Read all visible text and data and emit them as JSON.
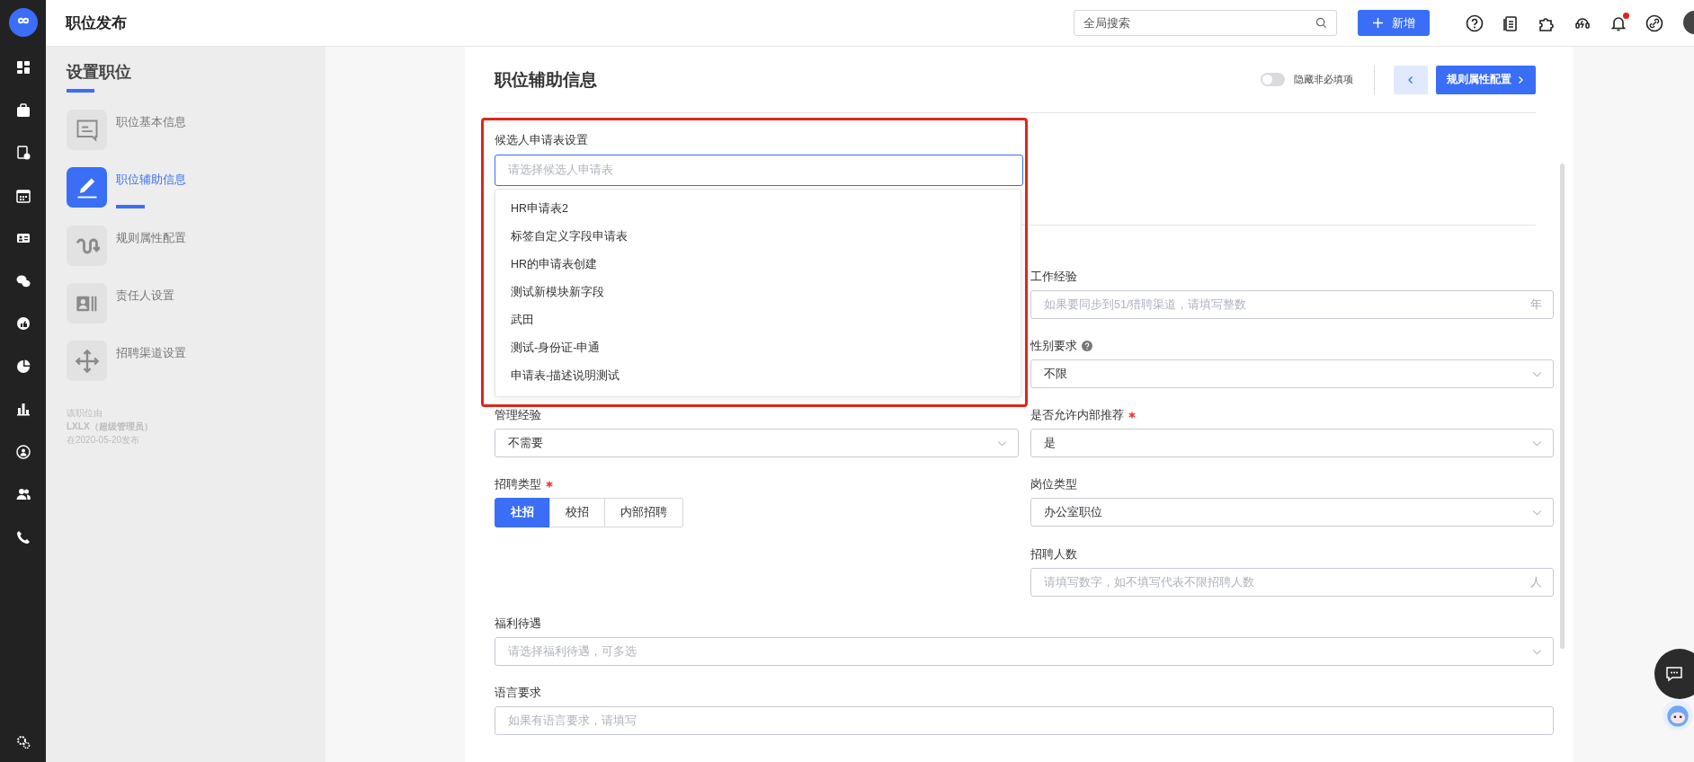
{
  "header": {
    "title": "职位发布",
    "search": {
      "placeholder": "全局搜索"
    },
    "new_button": "新增",
    "notification": true
  },
  "steps": {
    "title": "设置职位",
    "items": [
      {
        "label": "职位基本信息",
        "kind": "message",
        "selected": false
      },
      {
        "label": "职位辅助信息",
        "kind": "pencil",
        "selected": true
      },
      {
        "label": "规则属性配置",
        "kind": "wave",
        "selected": false
      },
      {
        "label": "责任人设置",
        "kind": "contact",
        "selected": false
      },
      {
        "label": "招聘渠道设置",
        "kind": "move",
        "selected": false
      }
    ],
    "note": [
      "该职位由",
      "LXLX（超级管理员）",
      "在2020-05-20发布"
    ]
  },
  "page": {
    "title": "职位辅助信息",
    "hide_optional": {
      "label": "隐藏非必填项",
      "on": false
    },
    "next_button": "规则属性配置"
  },
  "application_form": {
    "label": "候选人申请表设置",
    "placeholder": "请选择候选人申请表",
    "expanded": true,
    "highlighted": true,
    "options": [
      {
        "label": "HR申请表2",
        "selected": false
      },
      {
        "label": "标签自定义字段申请表",
        "selected": false
      },
      {
        "label": "HR的申请表创建",
        "selected": false
      },
      {
        "label": "测试新模块新字段",
        "selected": false
      },
      {
        "label": "武田",
        "selected": false
      },
      {
        "label": "测试-身份证-申通",
        "selected": false
      },
      {
        "label": "申请表-描述说明测试",
        "selected": false
      }
    ]
  },
  "rows": [
    {
      "right": {
        "kind": "input",
        "label": "工作经验",
        "placeholder": "如果要同步到51/猎聘渠道，请填写整数",
        "suffix": "年"
      }
    },
    {
      "right": {
        "kind": "select",
        "label": "性别要求",
        "help": true,
        "value": "不限"
      }
    },
    {
      "left": {
        "kind": "select",
        "label": "管理经验",
        "value": "不需要"
      },
      "right": {
        "kind": "select",
        "label": "是否允许内部推荐",
        "required": true,
        "value": "是"
      }
    },
    {
      "left": {
        "kind": "segmented",
        "label": "招聘类型",
        "required": true,
        "options": [
          {
            "label": "社招",
            "selected": true
          },
          {
            "label": "校招",
            "selected": false
          },
          {
            "label": "内部招聘",
            "selected": false
          }
        ]
      },
      "right": {
        "kind": "select",
        "label": "岗位类型",
        "value": "办公室职位"
      }
    },
    {
      "right": {
        "kind": "input",
        "label": "招聘人数",
        "placeholder": "请填写数字，如不填写代表不限招聘人数",
        "suffix": "人"
      }
    },
    {
      "full": {
        "kind": "select",
        "label": "福利待遇",
        "placeholder": "请选择福利待遇，可多选"
      }
    },
    {
      "full": {
        "kind": "input",
        "label": "语言要求",
        "placeholder": "如果有语言要求，请填写"
      }
    }
  ]
}
